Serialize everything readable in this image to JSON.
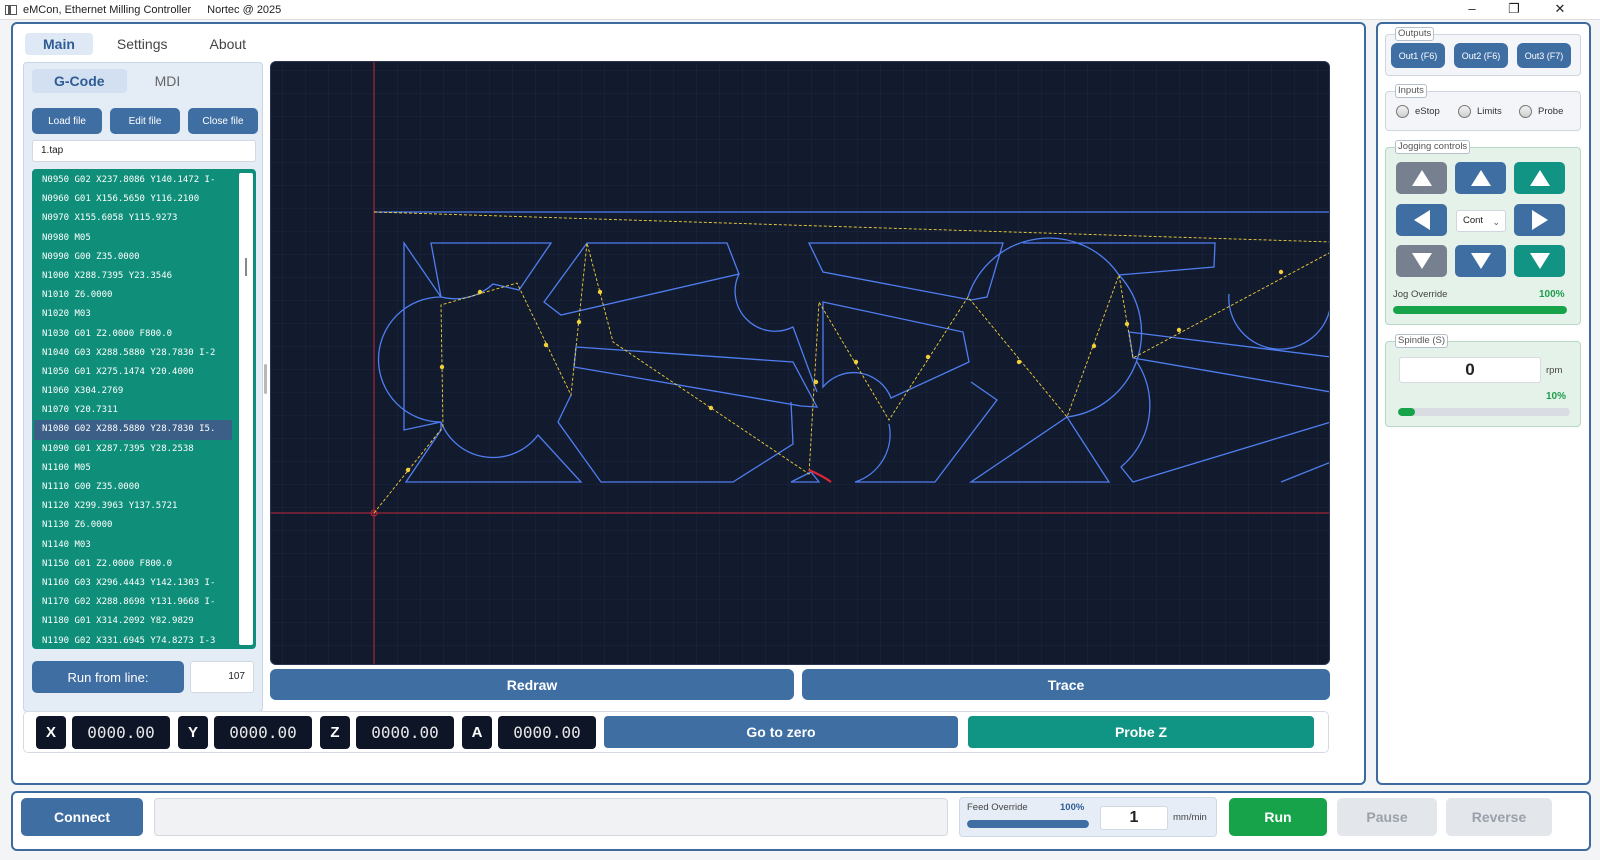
{
  "window": {
    "title": "eMCon, Ethernet Milling Controller",
    "copyright": "Nortec @ 2025",
    "minimize_icon": "minimize-icon",
    "maximize_icon": "restore-icon",
    "close_icon": "close-icon"
  },
  "tabs": [
    "Main",
    "Settings",
    "About"
  ],
  "gcode_panel": {
    "subtabs": [
      "G-Code",
      "MDI"
    ],
    "load_label": "Load file",
    "edit_label": "Edit file",
    "close_label": "Close file",
    "filename": "1.tap",
    "lines": [
      "N0950  G02 X237.8086 Y140.1472 I-",
      "N0960  G01 X156.5650 Y116.2100",
      "N0970  X155.6058 Y115.9273",
      "N0980  M05",
      "N0990  G00 Z35.0000",
      "N1000  X288.7395 Y23.3546",
      "N1010  Z6.0000",
      "N1020  M03",
      "N1030  G01 Z2.0000 F800.0",
      "N1040  G03 X288.5880 Y28.7830 I-2",
      "N1050  G01 X275.1474 Y20.4000",
      "N1060  X304.2769",
      "N1070  Y20.7311",
      "N1080  G02 X288.5880 Y28.7830 I5.",
      "N1090  G01 X287.7395 Y28.2538",
      "N1100  M05",
      "N1110  G00 Z35.0000",
      "N1120  X299.3963 Y137.5721",
      "N1130  Z6.0000",
      "N1140  M03",
      "N1150  G01 Z2.0000 F800.0",
      "N1160  G03 X296.4443 Y142.1303 I-",
      "N1170  G02 X288.8698 Y131.9668 I-",
      "N1180  G01 X314.2092 Y82.9829",
      "N1190  G02 X331.6945 Y74.8273 I-3"
    ],
    "selected_index": 13,
    "run_from_label": "Run from line:",
    "run_from_value": "107"
  },
  "canvas_actions": {
    "redraw_label": "Redraw",
    "trace_label": "Trace"
  },
  "dro": [
    {
      "axis": "X",
      "value": "0000.00"
    },
    {
      "axis": "Y",
      "value": "0000.00"
    },
    {
      "axis": "Z",
      "value": "0000.00"
    },
    {
      "axis": "A",
      "value": "0000.00"
    }
  ],
  "dro_actions": {
    "go_zero_label": "Go to zero",
    "probe_label": "Probe Z"
  },
  "outputs": {
    "title": "Outputs",
    "buttons": [
      "Out1 (F6)",
      "Out2 (F6)",
      "Out3 (F7)"
    ]
  },
  "inputs": {
    "title": "Inputs",
    "items": [
      "eStop",
      "Limits",
      "Probe"
    ]
  },
  "jogging": {
    "title": "Jogging controls",
    "mode": "Cont",
    "override_label": "Jog Override",
    "override_value": "100%",
    "override_fraction": 1.0
  },
  "spindle": {
    "title": "Spindle (S)",
    "value": "0",
    "unit": "rpm",
    "percent": "10%",
    "fraction": 0.1
  },
  "bottom": {
    "connect_label": "Connect",
    "status_text": "",
    "feed_label": "Feed Override",
    "feed_percent": "100%",
    "feed_fraction": 1.0,
    "feed_value": "1",
    "feed_unit": "mm/min",
    "run_label": "Run",
    "pause_label": "Pause",
    "reverse_label": "Reverse"
  },
  "colors": {
    "accent_blue": "#3f6ea3",
    "teal": "#0f8f7a",
    "run_green": "#17a34a",
    "canvas_bg": "#121a2e",
    "toolpath": "#4f7ef0",
    "rapid": "#f2d03b",
    "axis": "#c0283a"
  }
}
